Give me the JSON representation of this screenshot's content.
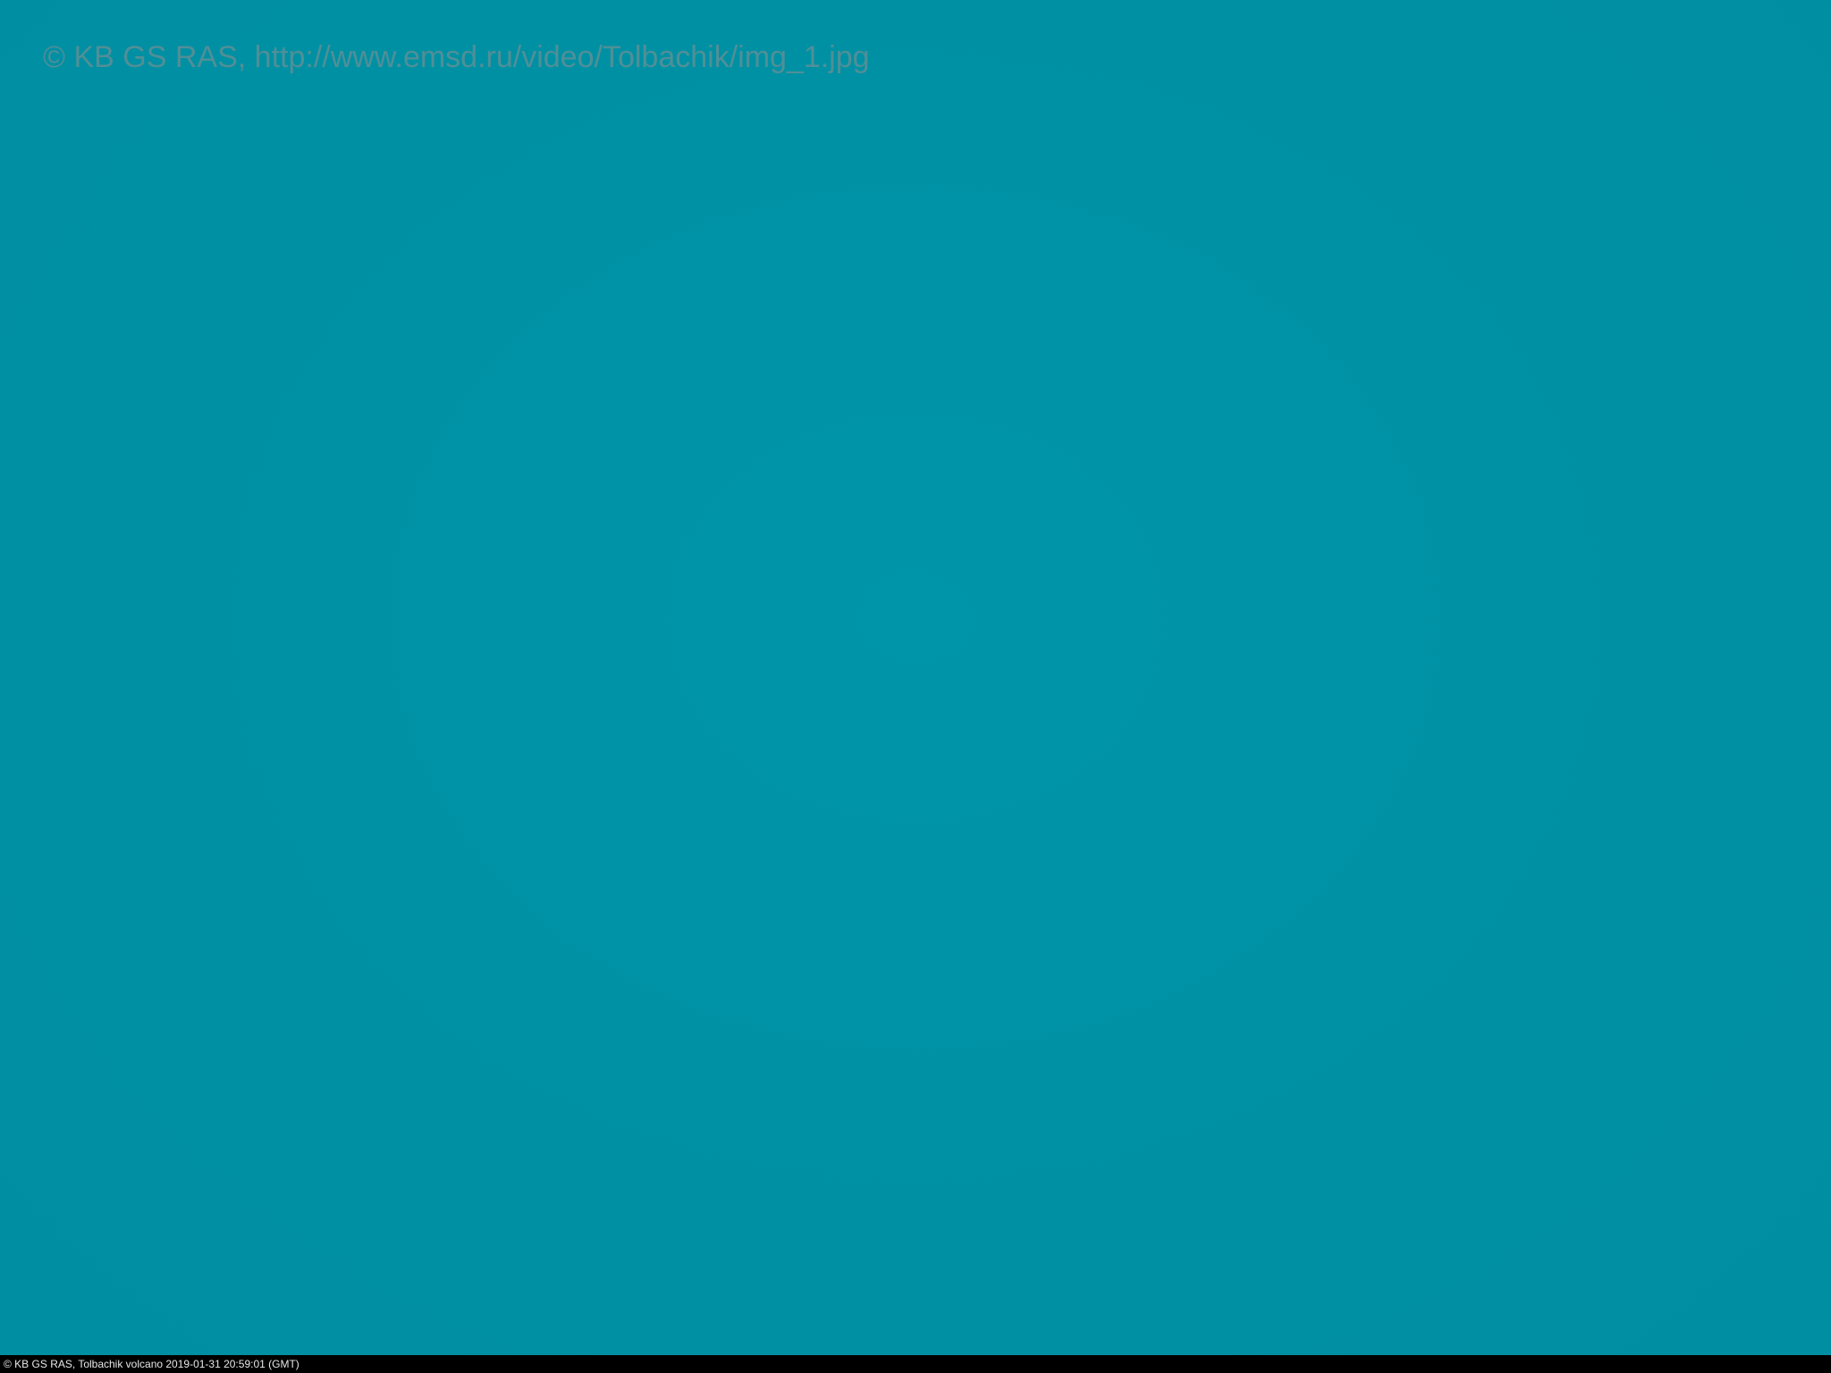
{
  "image": {
    "watermark_text": "© KB GS RAS, http://www.emsd.ru/video/Tolbachik/img_1.jpg",
    "status_caption": "© KB GS RAS, Tolbachik volcano 2019-01-31 20:59:01 (GMT)"
  },
  "colors": {
    "sky": "#0092a6",
    "watermark": "#5f8f95",
    "status_bar_bg": "#000000",
    "status_bar_text": "#e8e8e8"
  }
}
